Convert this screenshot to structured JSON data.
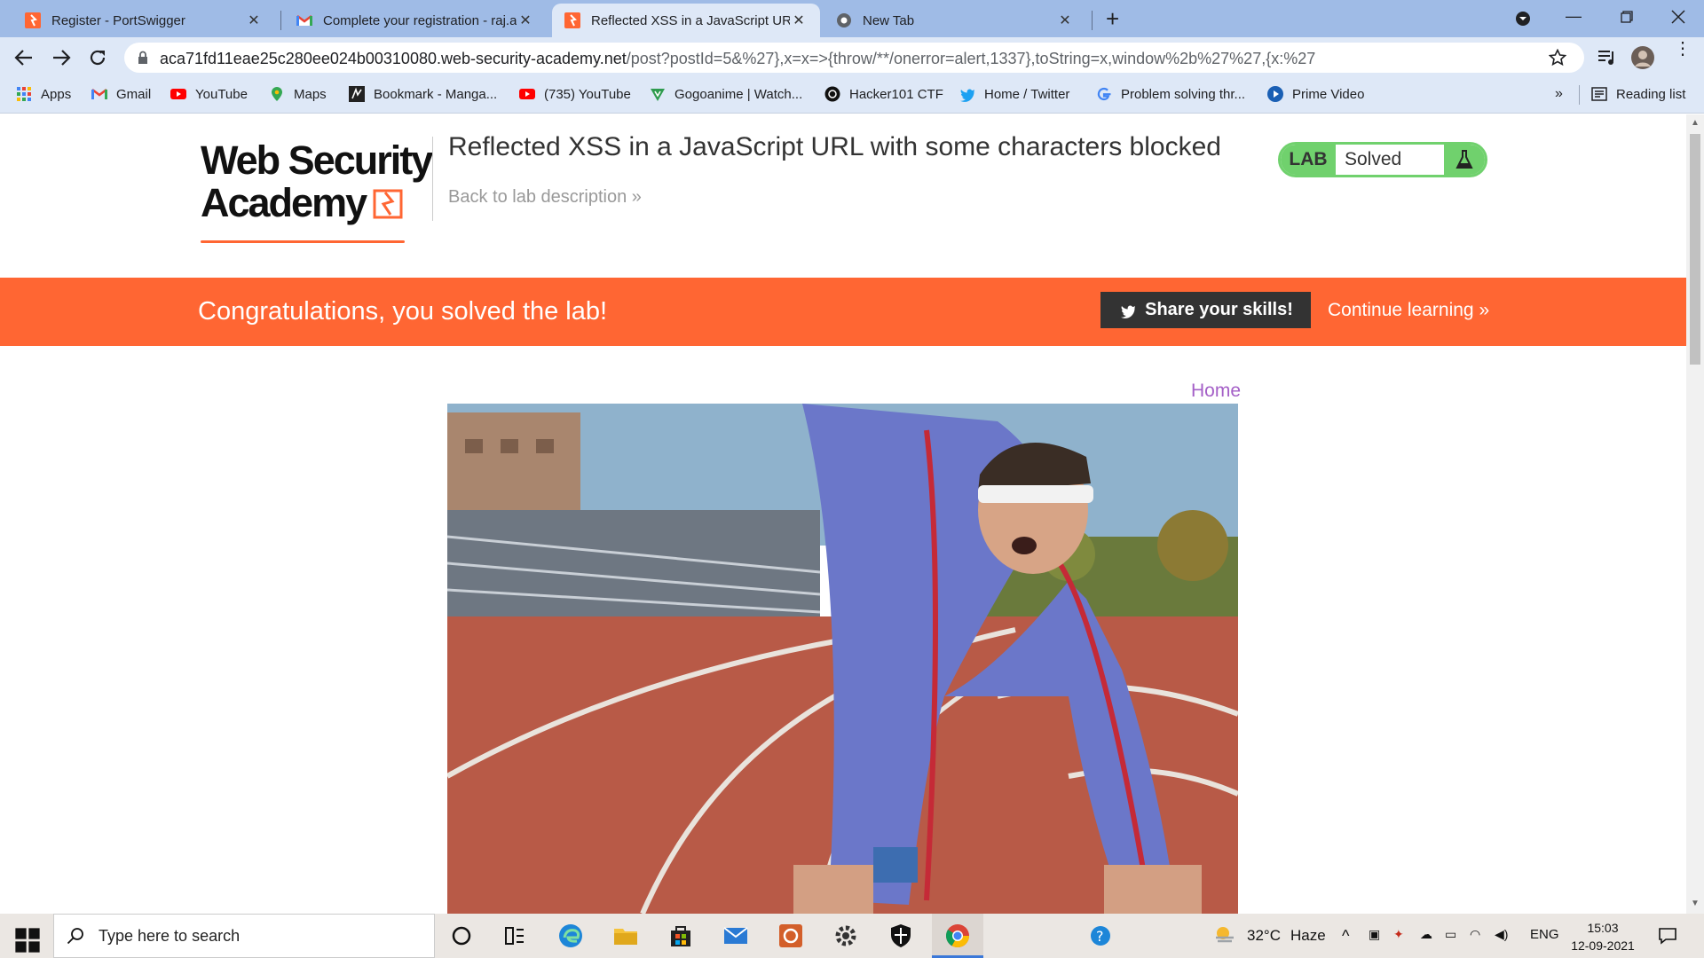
{
  "browser": {
    "tabs": [
      {
        "title": "Register - PortSwigger",
        "favicon": "portswigger-icon"
      },
      {
        "title": "Complete your registration - raj.a",
        "favicon": "gmail-icon"
      },
      {
        "title": "Reflected XSS in a JavaScript URL",
        "favicon": "portswigger-icon",
        "active": true
      },
      {
        "title": "New Tab",
        "favicon": "chrome-icon"
      }
    ],
    "new_tab_label": "+",
    "close_label": "✕",
    "url_main": "aca71fd11eae25c280ee024b00310080.web-security-academy.net",
    "url_path": "/post?postId=5&%27},x=x=>{throw/**/onerror=alert,1337},toString=x,window%2b%27%27,{x:%27",
    "bookmarks": [
      {
        "label": "Apps",
        "icon": "apps-grid-icon"
      },
      {
        "label": "Gmail",
        "icon": "gmail-icon"
      },
      {
        "label": "YouTube",
        "icon": "youtube-icon"
      },
      {
        "label": "Maps",
        "icon": "maps-icon"
      },
      {
        "label": "Bookmark - Manga...",
        "icon": "manga-icon"
      },
      {
        "label": "(735) YouTube",
        "icon": "youtube-icon"
      },
      {
        "label": "Gogoanime | Watch...",
        "icon": "gogoanime-icon"
      },
      {
        "label": "Hacker101 CTF",
        "icon": "hacker101-icon"
      },
      {
        "label": "Home / Twitter",
        "icon": "twitter-icon"
      },
      {
        "label": "Problem solving thr...",
        "icon": "google-icon"
      },
      {
        "label": "Prime Video",
        "icon": "prime-video-icon"
      }
    ],
    "more_bookmarks": "»",
    "reading_list": "Reading list"
  },
  "page": {
    "logo_line1": "Web Security",
    "logo_line2": "Academy",
    "lab_title": "Reflected XSS in a JavaScript URL with some characters blocked",
    "back_link": "Back to lab description »",
    "lab_tag": "LAB",
    "lab_status": "Solved",
    "banner_text": "Congratulations, you solved the lab!",
    "share_button": "Share your skills!",
    "continue_link": "Continue learning »",
    "home_link": "Home"
  },
  "taskbar": {
    "search_placeholder": "Type here to search",
    "weather_temp": "32°C",
    "weather_desc": "Haze",
    "language": "ENG",
    "time": "15:03",
    "date": "12-09-2021"
  },
  "colors": {
    "accent_orange": "#ff6633",
    "lab_green": "#70d16d",
    "link_purple": "#a45fc7"
  }
}
